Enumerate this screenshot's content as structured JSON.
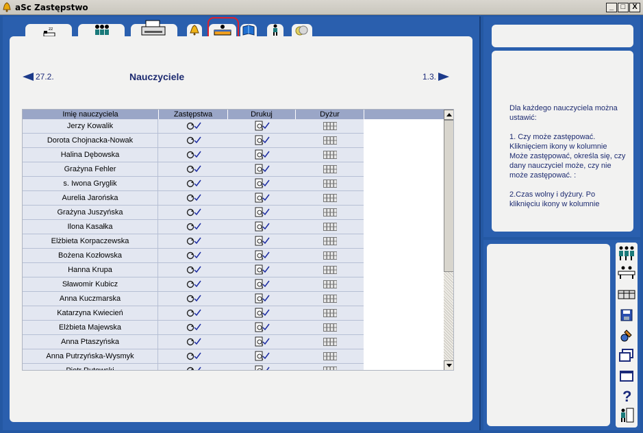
{
  "window": {
    "title": "aSc Zastępstwo",
    "buttons": [
      "_",
      "□",
      "X"
    ]
  },
  "tabs": [
    {
      "name": "absence",
      "icon": "sleeping-icon"
    },
    {
      "name": "teachers",
      "icon": "teachers-icon"
    },
    {
      "name": "print",
      "icon": "printer-icon"
    },
    {
      "name": "bell",
      "icon": "bell-icon"
    },
    {
      "name": "teacher-settings",
      "icon": "teacher-desk-icon",
      "active": true
    },
    {
      "name": "book",
      "icon": "book-icon"
    },
    {
      "name": "person",
      "icon": "person-icon"
    },
    {
      "name": "coins",
      "icon": "coins-icon"
    }
  ],
  "nav": {
    "prev_label": "27.2.",
    "next_label": "1.3.",
    "heading": "Nauczyciele"
  },
  "table": {
    "columns": [
      "Imię nauczyciela",
      "Zastępstwa",
      "Drukuj",
      "Dyżur"
    ],
    "rows": [
      "Jerzy Kowalik",
      "Dorota Chojnacka-Nowak",
      "Halina Dębowska",
      "Grażyna Fehler",
      "s. Iwona Gryglik",
      "Aurelia Jarońska",
      "Grażyna Juszyńska",
      "Ilona Kasałka",
      "Elżbieta Korpaczewska",
      "Bożena Kozłowska",
      "Hanna Krupa",
      "Sławomir Kubicz",
      "Anna Kuczmarska",
      "Katarzyna Kwiecień",
      "Elżbieta Majewska",
      "Anna Ptaszyńska",
      "Anna Putrzyńska-Wysmyk",
      "Piotr Rutowski"
    ]
  },
  "info": {
    "paragraphs": [
      "Dla każdego nauczyciela można ustawić:",
      "1. Czy może zastępować. Kliknięciem ikony w kolumnie Może zastępować, określa się, czy dany nauczyciel może, czy nie może zastępować. :",
      "2.Czas wolny i dyżury. Po kliknięciu ikony w kolumnie"
    ]
  },
  "side_buttons": [
    {
      "name": "teachers-group-icon"
    },
    {
      "name": "classroom-icon"
    },
    {
      "name": "table-icon"
    },
    {
      "name": "save-icon"
    },
    {
      "name": "tools-icon"
    },
    {
      "name": "windows-icon"
    },
    {
      "name": "window-icon"
    },
    {
      "name": "help-icon"
    },
    {
      "name": "exit-icon"
    }
  ],
  "colors": {
    "frame_blue": "#2a5fae",
    "panel": "#f2f2f1",
    "highlight_red": "#e0202a",
    "text_navy": "#1c2a70"
  }
}
